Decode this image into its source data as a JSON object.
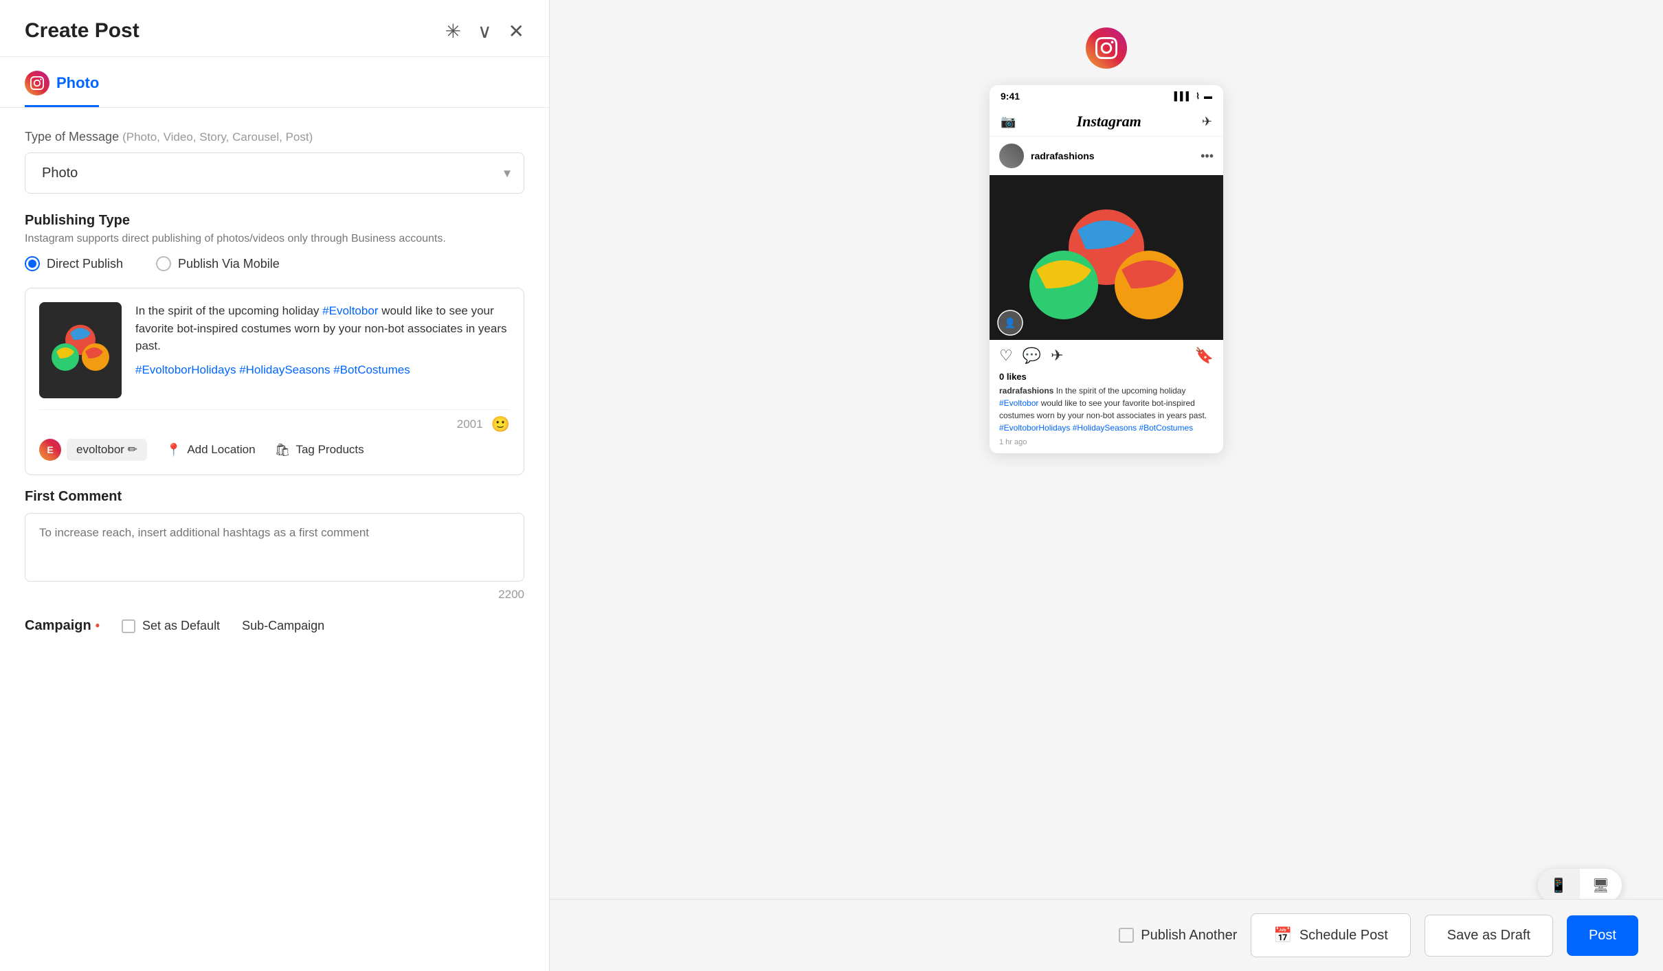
{
  "header": {
    "title": "Create Post",
    "pin_icon": "📌",
    "chevron_icon": "▼",
    "close_icon": "✕"
  },
  "tab": {
    "label": "Photo"
  },
  "form": {
    "type_of_message": {
      "label": "Type of Message",
      "hint": "(Photo, Video, Story, Carousel, Post)",
      "selected": "Photo",
      "options": [
        "Photo",
        "Video",
        "Story",
        "Carousel",
        "Post"
      ]
    },
    "publishing_type": {
      "label": "Publishing Type",
      "description": "Instagram supports direct publishing of photos/videos only through Business accounts.",
      "options": [
        "Direct Publish",
        "Publish Via Mobile"
      ],
      "selected": "Direct Publish"
    },
    "post": {
      "text": "In the spirit of the upcoming holiday ",
      "mention": "#Evoltobor",
      "text2": " would like to see your favorite bot-inspired costumes worn by your non-bot associates in years past.",
      "hashtags": "#EvoltoborHolidays #HolidaySeasons #BotCostumes",
      "char_count": "2001",
      "account_name": "evoltobor ✏",
      "add_location": "Add Location",
      "tag_products": "Tag Products"
    },
    "first_comment": {
      "label": "First Comment",
      "placeholder": "To increase reach, insert additional hashtags as a first comment",
      "char_count": "2200"
    },
    "campaign": {
      "label": "Campaign",
      "required": true,
      "set_as_default": "Set as Default",
      "sub_campaign": "Sub-Campaign"
    }
  },
  "preview": {
    "phone": {
      "time": "9:41",
      "username": "radrafashions",
      "likes": "0 likes",
      "caption_username": "radrafashions",
      "caption_text": " In the spirit of the upcoming holiday ",
      "caption_mention": "#Evoltobor",
      "caption_text2": " would like to see your favorite bot-inspired costumes worn by your non-bot associates in years past.",
      "hashtags": "#EvoltoborHolidays #HolidaySeasons #BotCostumes",
      "time_ago": "1 hr ago"
    }
  },
  "footer": {
    "publish_another_label": "Publish Another",
    "schedule_post_label": "Schedule Post",
    "save_draft_label": "Save as Draft",
    "post_label": "Post"
  }
}
